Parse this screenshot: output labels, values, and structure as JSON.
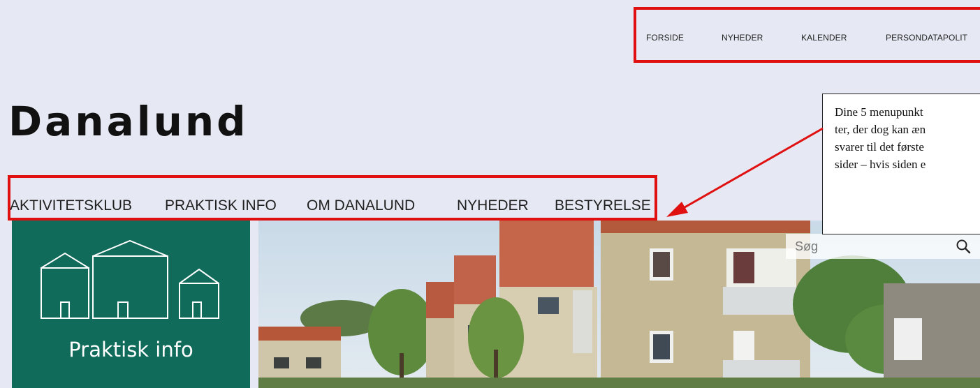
{
  "top_nav": {
    "items": [
      "FORSIDE",
      "NYHEDER",
      "KALENDER",
      "PERSONDATAPOLIT"
    ]
  },
  "site": {
    "title": "Danalund"
  },
  "main_nav": {
    "items": [
      "AKTIVITETSKLUB",
      "PRAKTISK INFO",
      "OM DANALUND",
      "NYHEDER",
      "BESTYRELSE"
    ]
  },
  "callout": {
    "lines": [
      "Dine 5 menupunkt",
      "ter, der dog kan æn",
      "svarer til det første",
      "sider – hvis siden e"
    ]
  },
  "tile": {
    "label": "Praktisk info",
    "icon": "houses-icon"
  },
  "search": {
    "placeholder": "Søg",
    "icon": "search-icon"
  },
  "colors": {
    "background": "#e6e9f3",
    "highlight_frame": "#e01010",
    "tile_green": "#116b5b"
  }
}
